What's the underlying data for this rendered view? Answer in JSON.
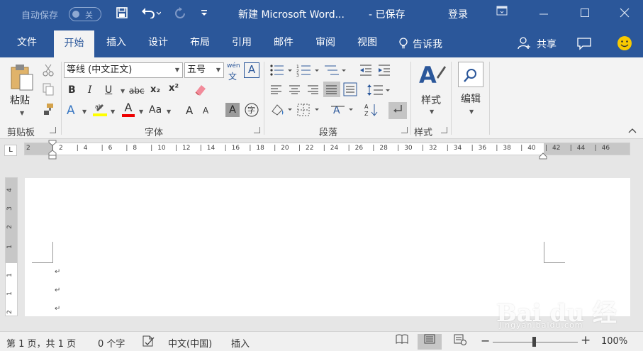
{
  "titlebar": {
    "autosave_label": "自动保存",
    "autosave_state": "关",
    "save_icon": "save-icon",
    "undo_icon": "undo-icon",
    "redo_icon": "redo-icon",
    "customize_icon": "customize-qat-icon",
    "document_title": "新建 Microsoft Word...",
    "save_status": "-  已保存",
    "login_label": "登录",
    "window_icons": [
      "ribbon-display-icon",
      "minimize-icon",
      "maximize-icon",
      "close-icon"
    ]
  },
  "tabs": [
    {
      "label": "文件",
      "active": false
    },
    {
      "label": "开始",
      "active": true
    },
    {
      "label": "插入",
      "active": false
    },
    {
      "label": "设计",
      "active": false
    },
    {
      "label": "布局",
      "active": false
    },
    {
      "label": "引用",
      "active": false
    },
    {
      "label": "邮件",
      "active": false
    },
    {
      "label": "审阅",
      "active": false
    },
    {
      "label": "视图",
      "active": false
    }
  ],
  "tellme_label": "告诉我",
  "share_label": "共享",
  "ribbon": {
    "clipboard": {
      "paste_label": "粘贴",
      "group_label": "剪贴板"
    },
    "font": {
      "font_name": "等线 (中文正文)",
      "font_size": "五号",
      "phonetic_label": "wén",
      "bold": "B",
      "italic": "I",
      "underline": "U",
      "strike": "abc",
      "subscript": "x₂",
      "superscript": "x²",
      "text_effects": "A",
      "font_color": "A",
      "change_case": "Aa",
      "grow": "A",
      "shrink": "A",
      "group_label": "字体"
    },
    "paragraph": {
      "group_label": "段落"
    },
    "styles": {
      "label": "样式",
      "group_label": "样式"
    },
    "editing": {
      "label": "编辑"
    }
  },
  "ruler": {
    "ticks": [
      "2",
      "2",
      "4",
      "6",
      "8",
      "10",
      "12",
      "14",
      "16",
      "18",
      "20",
      "22",
      "24",
      "26",
      "28",
      "30",
      "32",
      "34",
      "36",
      "38",
      "40",
      "42",
      "44",
      "46"
    ]
  },
  "vruler": {
    "numbers": [
      "4",
      "3",
      "2",
      "1",
      "1",
      "1",
      "2"
    ]
  },
  "document": {
    "paragraph_marks": [
      "↵",
      "↵",
      "↵"
    ]
  },
  "watermark": {
    "main": "Bai du 经验",
    "sub": "jingyan.baidu.com"
  },
  "statusbar": {
    "page_info": "第 1 页，共 1 页",
    "word_count": "0 个字",
    "language": "中文(中国)",
    "insert_mode": "插入",
    "zoom_label": "100%",
    "zoom_minus": "−",
    "zoom_plus": "+"
  }
}
